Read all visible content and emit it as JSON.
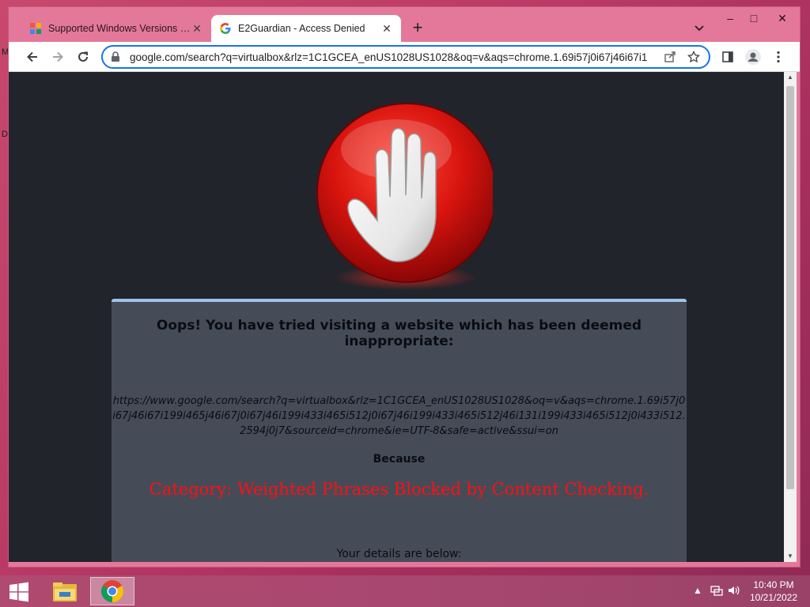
{
  "desktop": {
    "glyphs": [
      "M",
      "D"
    ]
  },
  "window": {
    "tabs": [
      {
        "title": "Supported Windows Versions (up",
        "favicon": "puzzle-colorful-icon",
        "active": false
      },
      {
        "title": "E2Guardian - Access Denied",
        "favicon": "google-g-icon",
        "active": true
      }
    ],
    "controls": {
      "minimize": "–",
      "maximize": "□",
      "close": "✕"
    }
  },
  "toolbar": {
    "url": "google.com/search?q=virtualbox&rlz=1C1GCEA_enUS1028US1028&oq=v&aqs=chrome.1.69i57j0i67j46i67i1"
  },
  "page": {
    "heading": "Oops! You have tried visiting a website which has been deemed inappropriate:",
    "blocked_url": "https://www.google.com/search?q=virtualbox&rlz=1C1GCEA_enUS1028US1028&oq=v&aqs=chrome.1.69i57j0i67j46i67i199i465j46i67j0i67j46i199i433i465i512j0i67j46i199i433i465i512j46i131i199i433i465i512j0i433i512.2594j0j7&sourceid=chrome&ie=UTF-8&safe=active&ssui=on",
    "because_label": "Because",
    "reason": "Category: Weighted Phrases  Blocked by Content Checking.",
    "details_label": "Your details are below:"
  },
  "colors": {
    "reason": "#ff1010",
    "panel_border": "#9ec3e6",
    "page_bg": "#22242c"
  },
  "taskbar": {
    "apps": [
      "file-explorer-icon",
      "chrome-icon"
    ],
    "clock": {
      "time": "10:40 PM",
      "date": "10/21/2022"
    }
  }
}
